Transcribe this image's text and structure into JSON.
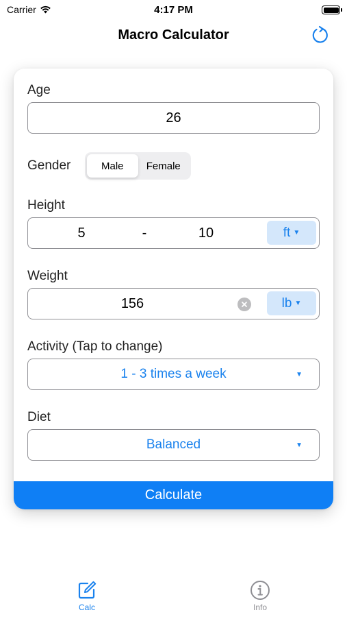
{
  "status": {
    "carrier": "Carrier",
    "time": "4:17 PM",
    "battery_level": 1.0
  },
  "nav": {
    "title": "Macro Calculator",
    "refresh_icon": "refresh-icon"
  },
  "form": {
    "age": {
      "label": "Age",
      "value": "26"
    },
    "gender": {
      "label": "Gender",
      "options": [
        "Male",
        "Female"
      ],
      "selected": "Male"
    },
    "height": {
      "label": "Height",
      "feet": "5",
      "separator": "-",
      "inches": "10",
      "unit": "ft"
    },
    "weight": {
      "label": "Weight",
      "value": "156",
      "unit": "lb"
    },
    "activity": {
      "label": "Activity (Tap to change)",
      "value": "1 - 3 times a week"
    },
    "diet": {
      "label": "Diet",
      "value": "Balanced"
    },
    "calculate_label": "Calculate"
  },
  "tabs": [
    {
      "label": "Calc",
      "icon": "edit-icon",
      "active": true
    },
    {
      "label": "Info",
      "icon": "info-icon",
      "active": false
    }
  ],
  "colors": {
    "accent": "#1a82ed",
    "button": "#0f7ff5",
    "unit_bg": "#d4e7fb",
    "inactive": "#8e8e93"
  }
}
